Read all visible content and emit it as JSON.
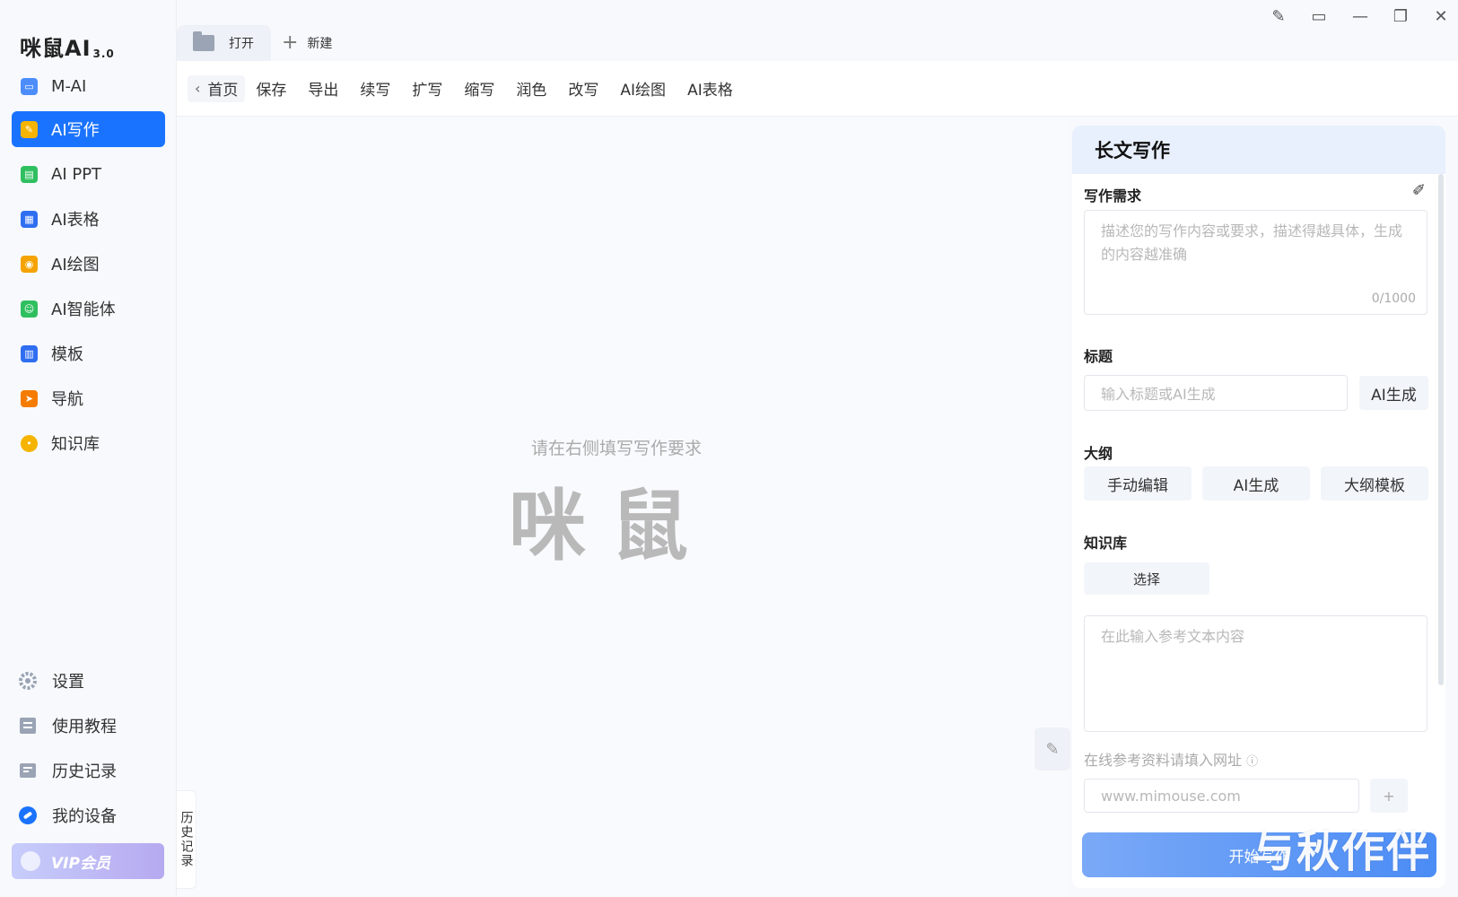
{
  "app": {
    "logo_text": "咪鼠AI",
    "logo_version": "3.0"
  },
  "sidebar": {
    "items": [
      {
        "label": "M-AI",
        "icon": "chat-icon",
        "color": "#4c8dfb"
      },
      {
        "label": "AI写作",
        "icon": "write-icon",
        "color": "#f5b400",
        "active": true
      },
      {
        "label": "AI PPT",
        "icon": "ppt-icon",
        "color": "#2fbf5f"
      },
      {
        "label": "AI表格",
        "icon": "table-icon",
        "color": "#2f6ef0"
      },
      {
        "label": "AI绘图",
        "icon": "palette-icon",
        "color": "#f5a300"
      },
      {
        "label": "AI智能体",
        "icon": "robot-icon",
        "color": "#2fbf5f"
      },
      {
        "label": "模板",
        "icon": "template-icon",
        "color": "#2f6ef0"
      },
      {
        "label": "导航",
        "icon": "navigation-icon",
        "color": "#f57c00"
      },
      {
        "label": "知识库",
        "icon": "bulb-icon",
        "color": "#f5b400"
      }
    ],
    "bottom": [
      {
        "label": "设置",
        "icon": "gear-icon"
      },
      {
        "label": "使用教程",
        "icon": "tutorial-icon"
      },
      {
        "label": "历史记录",
        "icon": "history-icon"
      },
      {
        "label": "我的设备",
        "icon": "device-icon"
      }
    ],
    "vip_label": "VIP会员"
  },
  "tabs": {
    "open_label": "打开",
    "new_label": "新建"
  },
  "toolbar": {
    "home": "首页",
    "items": [
      "保存",
      "导出",
      "续写",
      "扩写",
      "缩写",
      "润色",
      "改写",
      "AI绘图",
      "AI表格"
    ]
  },
  "editor": {
    "hint": "请在右侧填写写作要求",
    "watermark": "咪鼠",
    "history_tab": "历史记录"
  },
  "panel": {
    "title": "长文写作",
    "req_label": "写作需求",
    "req_placeholder": "描述您的写作内容或要求，描述得越具体，生成的内容越准确",
    "req_counter": "0/1000",
    "title_label": "标题",
    "title_placeholder": "输入标题或AI生成",
    "title_ai_button": "AI生成",
    "outline_label": "大纲",
    "outline_buttons": [
      "手动编辑",
      "AI生成",
      "大纲模板"
    ],
    "kb_label": "知识库",
    "kb_select": "选择",
    "ref_placeholder": "在此输入参考文本内容",
    "url_label": "在线参考资料请填入网址",
    "url_placeholder": "www.mimouse.com",
    "start_button": "开始写作"
  },
  "overlay_watermark": "与秋作伴"
}
